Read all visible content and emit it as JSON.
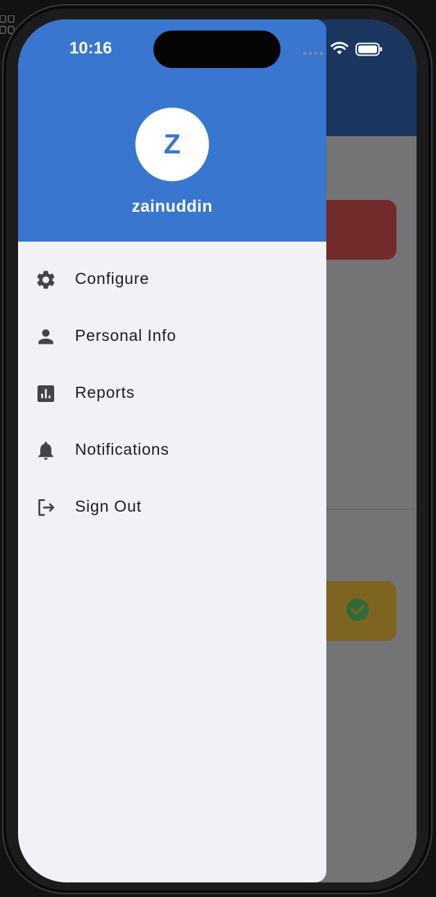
{
  "status_bar": {
    "time": "10:16"
  },
  "drawer": {
    "avatar_initial": "Z",
    "username": "zainuddin",
    "items": [
      {
        "label": "Configure",
        "icon": "gear-icon"
      },
      {
        "label": "Personal Info",
        "icon": "person-icon"
      },
      {
        "label": "Reports",
        "icon": "bar-chart-icon"
      },
      {
        "label": "Notifications",
        "icon": "bell-icon"
      },
      {
        "label": "Sign Out",
        "icon": "logout-icon"
      }
    ]
  },
  "colors": {
    "header_blue": "#3876cf",
    "drawer_bg": "#f3f1f8",
    "icon_dark": "#45434a",
    "scrim": "#747375"
  }
}
